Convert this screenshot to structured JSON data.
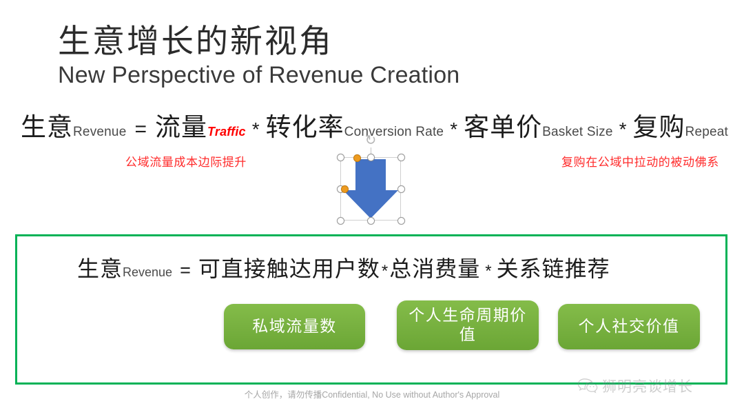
{
  "title": {
    "cn": "生意增长的新视角",
    "en": "New Perspective of Revenue Creation"
  },
  "formula_top": {
    "terms": [
      {
        "cn": "生意",
        "sub": "Revenue",
        "sub_accent": false
      },
      {
        "cn": "流量",
        "sub": "Traffic",
        "sub_accent": true
      },
      {
        "cn": "转化率",
        "sub": "Conversion Rate",
        "sub_accent": false
      },
      {
        "cn": "客单价",
        "sub": "Basket Size",
        "sub_accent": false
      },
      {
        "cn": "复购",
        "sub": "Repeat",
        "sub_accent": false
      }
    ],
    "equals": "=",
    "operator": "*",
    "accent_color": "#ff0000"
  },
  "annotations": {
    "left": "公域流量成本边际提升",
    "right": "复购在公域中拉动的被动佛系",
    "color": "#ff2b2b"
  },
  "arrow_shape": {
    "name": "down-arrow",
    "fill_color": "#4472c4",
    "selected": true,
    "rotation_handle_icon": "rotate-icon",
    "handle_color": "#ffffff",
    "adjust_handle_color": "#ed9b20"
  },
  "green_panel": {
    "border_color": "#00b256",
    "formula": {
      "terms": [
        {
          "cn": "生意",
          "sub": "Revenue"
        },
        {
          "cn": "可直接触达用户数",
          "sub": ""
        },
        {
          "cn": "总消费量",
          "sub": ""
        },
        {
          "cn": "关系链推荐",
          "sub": ""
        }
      ],
      "equals": "=",
      "operator": "*"
    },
    "pills": [
      {
        "label": "私域流量数"
      },
      {
        "label": "个人生命周期价值"
      },
      {
        "label": "个人社交价值"
      }
    ],
    "pill_color": "#79b241"
  },
  "footer": {
    "text": "个人创作，请勿传播Confidential, No Use without Author's Approval"
  },
  "watermark": {
    "icon": "wechat-icon",
    "text": "狮明亮谈增长"
  }
}
